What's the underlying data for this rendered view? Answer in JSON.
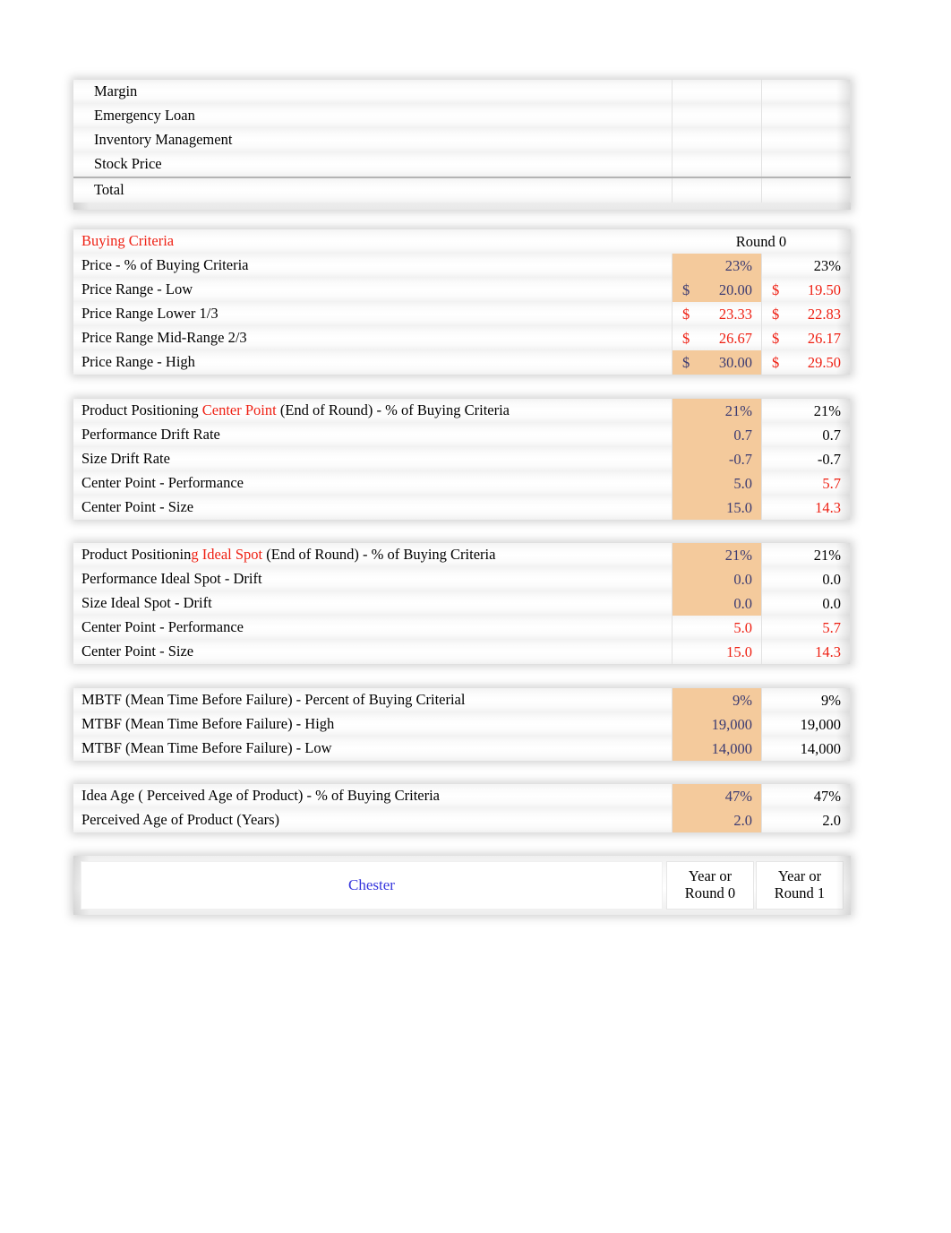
{
  "colors": {
    "highlight_fill": "#f4ca9c",
    "accent_red": "#ee2013",
    "value_navy": "#3b3b72",
    "company_blue": "#3535dd"
  },
  "top_section": {
    "rows": [
      {
        "label": "Margin",
        "col1": "",
        "col2": ""
      },
      {
        "label": "Emergency Loan",
        "col1": "",
        "col2": ""
      },
      {
        "label": "Inventory Management",
        "col1": "",
        "col2": ""
      },
      {
        "label": "Stock Price",
        "col1": "",
        "col2": ""
      },
      {
        "label": "Total",
        "col1": "",
        "col2": ""
      }
    ]
  },
  "buying_criteria": {
    "title": "Buying Criteria",
    "round_header": "Round 0",
    "rows": [
      {
        "label": "Price - % of Buying Criteria",
        "col1": "23%",
        "col2": "23%"
      },
      {
        "label": "Price Range - Low",
        "cur1": "$",
        "col1": "20.00",
        "cur2": "$",
        "col2": "19.50"
      },
      {
        "label": "Price Range Lower 1/3",
        "cur1": "$",
        "col1": "23.33",
        "cur2": "$",
        "col2": "22.83"
      },
      {
        "label": "Price Range Mid-Range 2/3",
        "cur1": "$",
        "col1": "26.67",
        "cur2": "$",
        "col2": "26.17"
      },
      {
        "label": "Price Range - High",
        "cur1": "$",
        "col1": "30.00",
        "cur2": "$",
        "col2": "29.50"
      }
    ]
  },
  "product_positioning_center": {
    "title_part1": "Product Positioning ",
    "title_accent": "Center Point",
    "title_part2": " (End of Round) - % of Buying Criteria",
    "rows": [
      {
        "label": "Performance Drift Rate",
        "col1": "0.7",
        "col2": "0.7"
      },
      {
        "label": "Size Drift Rate",
        "col1": "-0.7",
        "col2": "-0.7"
      },
      {
        "label": "Center Point - Performance",
        "col1": "5.0",
        "col2": "5.7"
      },
      {
        "label": "Center Point - Size",
        "col1": "15.0",
        "col2": "14.3"
      }
    ],
    "header_col1": "21%",
    "header_col2": "21%"
  },
  "product_positioning_ideal": {
    "title_part1": "Product Positionin",
    "title_accent": "g Ideal Spot",
    "title_part2": " (End of Round) - % of Buying Criteria",
    "rows": [
      {
        "label": "Performance Ideal Spot - Drift",
        "col1": "0.0",
        "col2": "0.0"
      },
      {
        "label": "Size Ideal Spot - Drift",
        "col1": "0.0",
        "col2": "0.0"
      },
      {
        "label": "Center Point - Performance",
        "col1": "5.0",
        "col2": "5.7"
      },
      {
        "label": "Center Point - Size",
        "col1": "15.0",
        "col2": "14.3"
      }
    ],
    "header_col1": "21%",
    "header_col2": "21%"
  },
  "mtbf": {
    "rows": [
      {
        "label": "MBTF (Mean Time Before Failure) - Percent of Buying Criterial",
        "col1": "9%",
        "col2": "9%"
      },
      {
        "label": "MTBF (Mean Time Before Failure) - High",
        "col1": "19,000",
        "col2": "19,000"
      },
      {
        "label": "MTBF (Mean Time Before Failure) - Low",
        "col1": "14,000",
        "col2": "14,000"
      }
    ]
  },
  "idea_age": {
    "rows": [
      {
        "label": "Idea Age ( Perceived Age of Product) - % of Buying Criteria",
        "col1": "47%",
        "col2": "47%"
      },
      {
        "label": "Perceived Age of Product (Years)",
        "col1": "2.0",
        "col2": "2.0"
      }
    ]
  },
  "footer": {
    "company": "Chester",
    "col1_line1": "Year or",
    "col1_line2": "Round 0",
    "col2_line1": "Year or",
    "col2_line2": "Round 1"
  }
}
